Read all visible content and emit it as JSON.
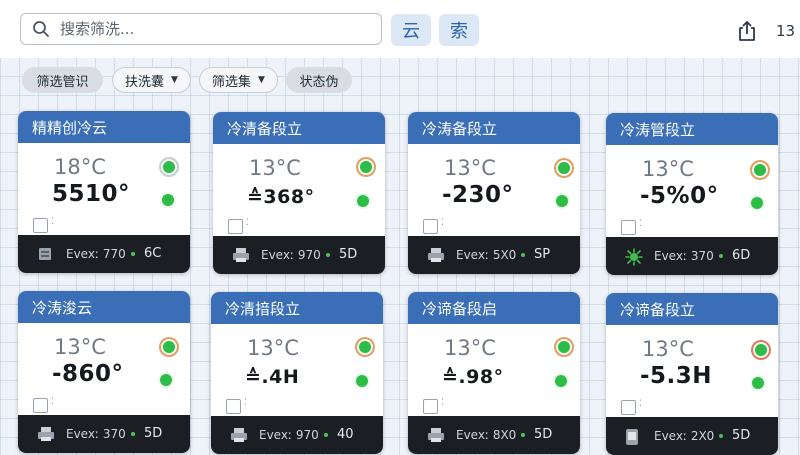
{
  "search": {
    "placeholder": "搜索筛洗..."
  },
  "toolbar": {
    "btn_cloud": "云",
    "btn_search": "索",
    "count": "13"
  },
  "filters": [
    {
      "label": "筛选管识",
      "dropdown": false
    },
    {
      "label": "扶洗囊",
      "dropdown": true
    },
    {
      "label": "筛选集",
      "dropdown": true
    },
    {
      "label": "状态伪",
      "dropdown": false
    }
  ],
  "colors": {
    "header_blue": "#3a6fb8",
    "status_green": "#2dbd47",
    "footer_dark": "#1b1e23"
  },
  "cards": [
    {
      "title": "精精创冷云",
      "temp": "18°C",
      "value": "5510°",
      "footer_text": "Evexː 770",
      "footer_num": "6C",
      "footer_icon": "server-icon"
    },
    {
      "title": "冷清备段立",
      "temp": "13°C",
      "value": "≙368°",
      "footer_text": "Evexː 970",
      "footer_num": "5D",
      "footer_icon": "printer-icon"
    },
    {
      "title": "冷涛备段立",
      "temp": "13°C",
      "value": "-230°",
      "footer_text": "Evexː 5X0",
      "footer_num": "SP",
      "footer_icon": "printer-icon"
    },
    {
      "title": "冷涛管段立",
      "temp": "13°C",
      "value": "-5%0°",
      "footer_text": "Evexː 370",
      "footer_num": "6D",
      "footer_icon": "bug-icon"
    },
    {
      "title": "冷涛浚云",
      "temp": "13°C",
      "value": "-860°",
      "footer_text": "Evexː 370",
      "footer_num": "5D",
      "footer_icon": "printer-icon"
    },
    {
      "title": "冷清揞段立",
      "temp": "13°C",
      "value": "≙.4H",
      "footer_text": "Evexː 970",
      "footer_num": "40",
      "footer_icon": "printer-icon"
    },
    {
      "title": "冷谛备段启",
      "temp": "13°C",
      "value": "≙.98°",
      "footer_text": "Evexː 8X0",
      "footer_num": "5D",
      "footer_icon": "printer-icon"
    },
    {
      "title": "冷谛备段立",
      "temp": "13°C",
      "value": "-5.3H",
      "footer_text": "Evexː 2X0",
      "footer_num": "5D",
      "footer_icon": "device-icon"
    }
  ]
}
